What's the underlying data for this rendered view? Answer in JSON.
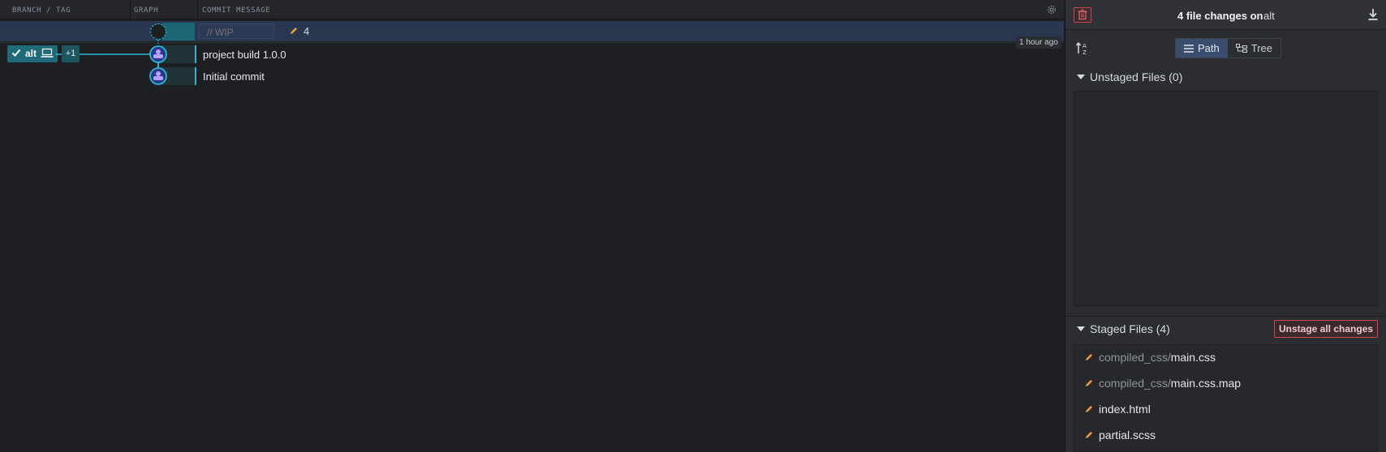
{
  "columns": {
    "branch": "BRANCH / TAG",
    "graph": "GRAPH",
    "message": "COMMIT MESSAGE"
  },
  "wip": {
    "placeholder": "// WIP",
    "count": "4"
  },
  "time_badge": "1 hour ago",
  "branch": {
    "name": "alt",
    "extra": "+1"
  },
  "commits": [
    {
      "message": "project build 1.0.0"
    },
    {
      "message": "Initial commit"
    }
  ],
  "panel": {
    "title": "4 file changes on",
    "branch": "alt",
    "view_path": "Path",
    "view_tree": "Tree",
    "unstaged_label": "Unstaged Files (0)",
    "staged_label": "Staged Files (4)",
    "unstage_all": "Unstage all changes",
    "files": [
      {
        "path": "compiled_css/",
        "name": "main.css"
      },
      {
        "path": "compiled_css/",
        "name": "main.css.map"
      },
      {
        "path": "",
        "name": "index.html"
      },
      {
        "path": "",
        "name": "partial.scss"
      }
    ]
  },
  "colors": {
    "accent": "#2bb7d2",
    "danger": "#d0484e",
    "modified": "#e8a33c"
  }
}
